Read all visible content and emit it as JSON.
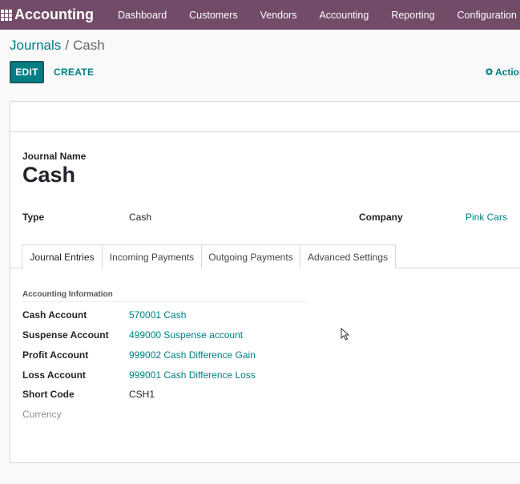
{
  "navbar": {
    "app_title": "Accounting",
    "menu": [
      "Dashboard",
      "Customers",
      "Vendors",
      "Accounting",
      "Reporting",
      "Configuration"
    ],
    "bg_color": "#714B67"
  },
  "breadcrumb": {
    "parent": "Journals",
    "separator": "/",
    "current": "Cash"
  },
  "buttons": {
    "edit": "EDIT",
    "create": "CREATE",
    "action": "Action"
  },
  "form": {
    "name_label": "Journal Name",
    "name_value": "Cash",
    "type_label": "Type",
    "type_value": "Cash",
    "company_label": "Company",
    "company_value": "Pink Cars"
  },
  "tabs": [
    "Journal Entries",
    "Incoming Payments",
    "Outgoing Payments",
    "Advanced Settings"
  ],
  "accounting_info": {
    "title": "Accounting Information",
    "fields": [
      {
        "label": "Cash Account",
        "value": "570001 Cash"
      },
      {
        "label": "Suspense Account",
        "value": "499000 Suspense account"
      },
      {
        "label": "Profit Account",
        "value": "999002 Cash Difference Gain"
      },
      {
        "label": "Loss Account",
        "value": "999001 Cash Difference Loss"
      },
      {
        "label": "Short Code",
        "value": "CSH1"
      },
      {
        "label": "Currency",
        "value": ""
      }
    ]
  },
  "colors": {
    "accent": "#017e84",
    "muted": "#8f8f8f"
  }
}
